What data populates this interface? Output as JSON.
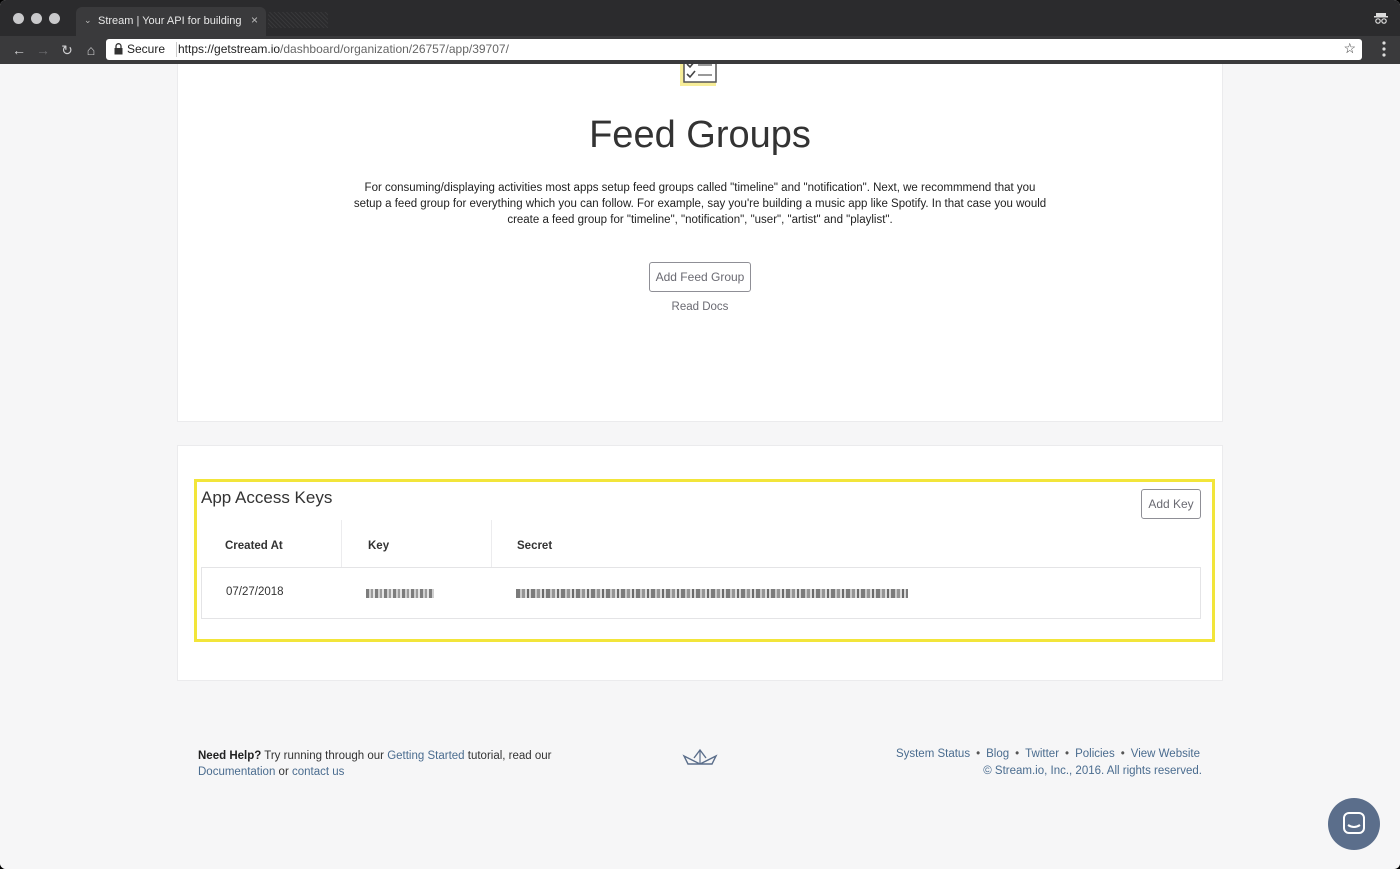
{
  "browser": {
    "tab_title": "Stream | Your API for building",
    "secure_label": "Secure",
    "url_host": "https://getstream.io",
    "url_path": "/dashboard/organization/26757/app/39707/"
  },
  "feed_groups": {
    "title": "Feed Groups",
    "description": "For consuming/displaying activities most apps setup feed groups called \"timeline\" and \"notification\". Next, we recommmend that you setup a feed group for everything which you can follow. For example, say you're building a music app like Spotify. In that case you would create a feed group for \"timeline\", \"notification\", \"user\", \"artist\" and \"playlist\".",
    "add_button": "Add Feed Group",
    "read_docs": "Read Docs"
  },
  "access_keys": {
    "title": "App Access Keys",
    "add_button": "Add Key",
    "columns": [
      "Created At",
      "Key",
      "Secret"
    ],
    "rows": [
      {
        "created_at": "07/27/2018"
      }
    ]
  },
  "footer": {
    "help_bold": "Need Help?",
    "help_text_1": " Try running through our ",
    "getting_started": "Getting Started",
    "help_text_2": " tutorial, read our ",
    "documentation": "Documentation",
    "help_text_3": " or ",
    "contact_us": "contact us",
    "links": [
      "System Status",
      "Blog",
      "Twitter",
      "Policies",
      "View Website"
    ],
    "copyright": "© Stream.io, Inc., 2016. All rights reserved."
  },
  "colors": {
    "highlight": "#f2e53a",
    "link": "#4a6c8f",
    "chat": "#5b6e8b"
  }
}
